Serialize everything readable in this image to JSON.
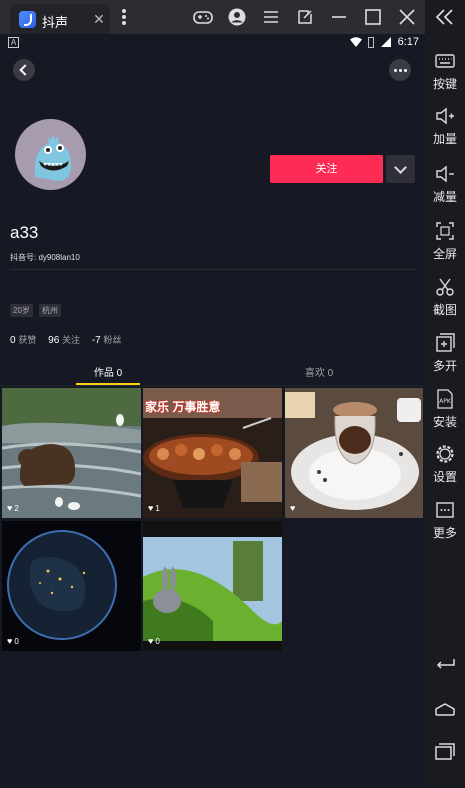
{
  "window": {
    "tab_title": "抖声",
    "tab_close": "✕",
    "icons": [
      "gamepad-icon",
      "account-icon",
      "menu-icon",
      "popout-icon",
      "minimize-icon",
      "maximize-icon",
      "close-icon"
    ]
  },
  "sidebar": {
    "items": [
      {
        "label": "按键",
        "icon": "keyboard-icon"
      },
      {
        "label": "加量",
        "icon": "volume-up-icon"
      },
      {
        "label": "减量",
        "icon": "volume-down-icon"
      },
      {
        "label": "全屏",
        "icon": "fullscreen-icon"
      },
      {
        "label": "截图",
        "icon": "scissors-icon"
      },
      {
        "label": "多开",
        "icon": "multi-instance-icon"
      },
      {
        "label": "安装",
        "icon": "apk-icon"
      },
      {
        "label": "设置",
        "icon": "settings-icon"
      },
      {
        "label": "更多",
        "icon": "more-icon"
      }
    ],
    "nav_icons": [
      "back-nav-icon",
      "home-nav-icon",
      "recents-nav-icon"
    ]
  },
  "status_bar": {
    "time": "6:17",
    "notification_icon": "A"
  },
  "profile": {
    "follow_label": "关注",
    "nickname": "a33",
    "douyin_id": "抖音号: dy908lan10",
    "tags": [
      "20岁",
      "杭州"
    ],
    "stats": [
      {
        "value": "0",
        "label": "获赞"
      },
      {
        "value": "96",
        "label": "关注"
      },
      {
        "value": "-7",
        "label": "粉丝"
      }
    ]
  },
  "tabs": {
    "works_label": "作品 0",
    "likes_label": "喜欢 0",
    "active": "works"
  },
  "videos": [
    {
      "name": "bear-video",
      "likes": "2"
    },
    {
      "name": "bbq-video",
      "likes": "1"
    },
    {
      "name": "dessert-video",
      "likes": ""
    },
    {
      "name": "earth-video",
      "likes": "0"
    },
    {
      "name": "bunny-video",
      "likes": "0"
    }
  ],
  "bbq_overlay_text": "家乐 万事胜意",
  "colors": {
    "follow_button": "#fe2c55",
    "active_tab_underline": "#face15",
    "background": "#161823"
  }
}
